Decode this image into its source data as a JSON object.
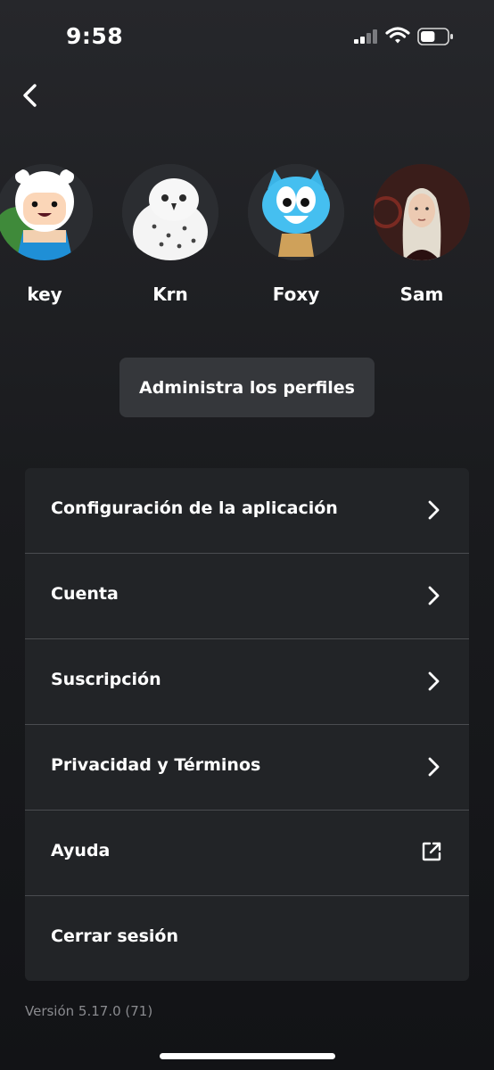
{
  "status_bar": {
    "time": "9:58",
    "signal_icon": "cellular-signal-icon",
    "wifi_icon": "wifi-icon",
    "battery_icon": "battery-icon",
    "battery_level_fraction": 0.55
  },
  "header": {
    "back_icon": "chevron-left-icon"
  },
  "profiles": [
    {
      "name": "key",
      "avatar": "finn-cartoon-avatar"
    },
    {
      "name": "Krn",
      "avatar": "snowy-owl-avatar"
    },
    {
      "name": "Foxy",
      "avatar": "gumball-cartoon-avatar"
    },
    {
      "name": "Sam",
      "avatar": "person-photo-avatar"
    }
  ],
  "manage_profiles_label": "Administra los perfiles",
  "menu": [
    {
      "label": "Configuración de la aplicación",
      "icon": "chevron-right-icon"
    },
    {
      "label": "Cuenta",
      "icon": "chevron-right-icon"
    },
    {
      "label": "Suscripción",
      "icon": "chevron-right-icon"
    },
    {
      "label": "Privacidad y Términos",
      "icon": "chevron-right-icon"
    },
    {
      "label": "Ayuda",
      "icon": "external-link-icon"
    },
    {
      "label": "Cerrar sesión",
      "icon": ""
    }
  ],
  "version": "Versión 5.17.0 (71)",
  "colors": {
    "background": "#1a1b1e",
    "menu_surface": "#222427",
    "button_surface": "#35373b",
    "divider": "#4a4c50",
    "muted_text": "#8a8b8f"
  }
}
